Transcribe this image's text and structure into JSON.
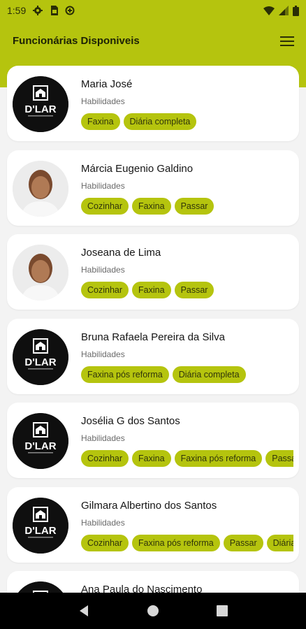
{
  "status": {
    "time": "1:59",
    "icons_left": [
      "gear-icon",
      "sim-card-icon",
      "data-saver-icon"
    ],
    "icons_right": [
      "wifi-icon",
      "signal-icon",
      "battery-icon"
    ]
  },
  "app_bar": {
    "title": "Funcionárias Disponiveis",
    "menu_icon": "menu-icon",
    "color": "#b5c40e"
  },
  "list_label": "Habilidades",
  "employees": [
    {
      "name": "Maria José",
      "avatar": "logo",
      "skills": [
        "Faxina",
        "Diária completa"
      ]
    },
    {
      "name": "Márcia Eugenio Galdino",
      "avatar": "photo",
      "skills": [
        "Cozinhar",
        "Faxina",
        "Passar"
      ]
    },
    {
      "name": "Joseana de Lima",
      "avatar": "photo",
      "skills": [
        "Cozinhar",
        "Faxina",
        "Passar"
      ]
    },
    {
      "name": "Bruna Rafaela Pereira da Silva",
      "avatar": "logo",
      "skills": [
        "Faxina pós reforma",
        "Diária completa"
      ]
    },
    {
      "name": "Josélia G dos Santos",
      "avatar": "logo",
      "skills": [
        "Cozinhar",
        "Faxina",
        "Faxina pós reforma",
        "Passar"
      ]
    },
    {
      "name": "Gilmara Albertino dos Santos",
      "avatar": "logo",
      "skills": [
        "Cozinhar",
        "Faxina pós reforma",
        "Passar",
        "Diária completa"
      ]
    },
    {
      "name": "Ana Paula do Nascimento",
      "avatar": "logo",
      "skills": []
    }
  ],
  "logo_text": "D'LAR",
  "nav": {
    "back_icon": "back-triangle-icon",
    "home_icon": "home-circle-icon",
    "recents_icon": "recents-square-icon"
  }
}
